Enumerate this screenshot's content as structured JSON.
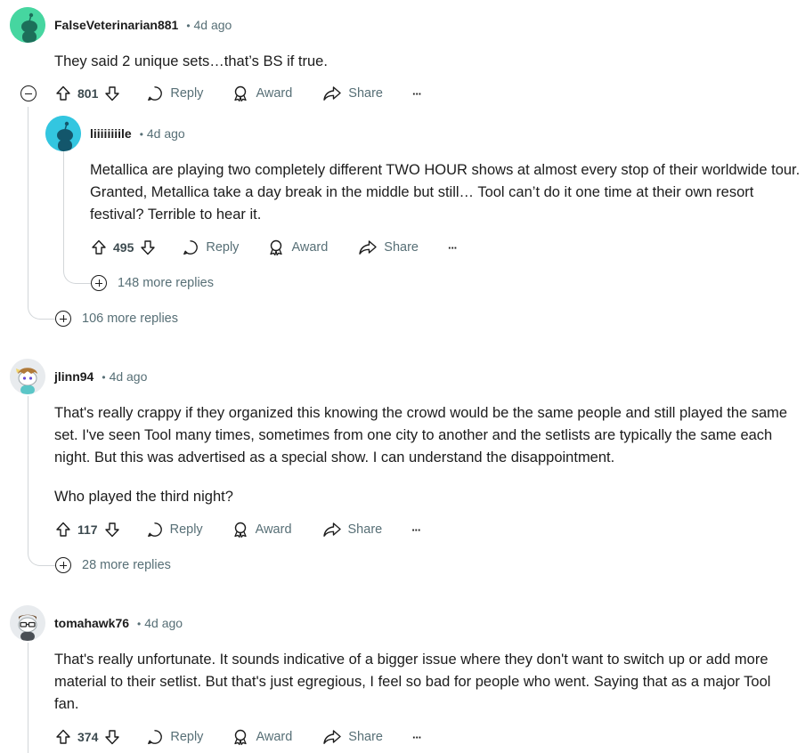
{
  "comments": [
    {
      "author": "FalseVeterinarian881",
      "time": "4d ago",
      "body": [
        "They said 2 unique sets…that’s BS if true."
      ],
      "score": "801",
      "more_replies": "106 more replies"
    },
    {
      "author": "liiiiiiiile",
      "time": "4d ago",
      "body": [
        "Metallica are playing two completely different TWO HOUR shows at almost every stop of their worldwide tour. Granted, Metallica take a day break in the middle but still… Tool can’t do it one time at their own resort festival? Terrible to hear it."
      ],
      "score": "495",
      "more_replies": "148 more replies"
    },
    {
      "author": "jlinn94",
      "time": "4d ago",
      "body": [
        "That's really crappy if they organized this knowing the crowd would be the same people and still played the same set. I've seen Tool many times, sometimes from one city to another and the setlists are typically the same each night. But this was advertised as a special show. I can understand the disappointment.",
        "Who played the third night?"
      ],
      "score": "117",
      "more_replies": "28 more replies"
    },
    {
      "author": "tomahawk76",
      "time": "4d ago",
      "body": [
        "That's really unfortunate. It sounds indicative of a bigger issue where they don't want to switch up or add more material to their setlist. But that's just egregious, I feel so bad for people who went. Saying that as a major Tool fan."
      ],
      "score": "374"
    }
  ],
  "actions": {
    "reply": "Reply",
    "award": "Award",
    "share": "Share",
    "overflow": "···",
    "separator": "•"
  },
  "colors": {
    "avatar_green": "#46d6a0",
    "avatar_teal": "#33c6e0",
    "muted_text": "#576f76",
    "thread_line": "#d2d6d9"
  }
}
